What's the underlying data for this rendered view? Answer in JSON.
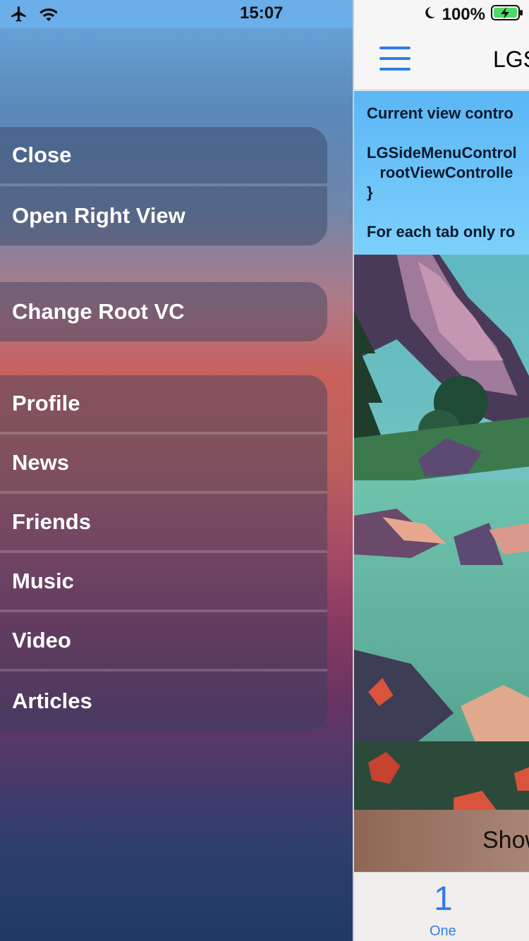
{
  "status_bar": {
    "time": "15:07",
    "battery_percent": "100%",
    "icons": [
      "airplane-icon",
      "wifi-icon",
      "moon-icon",
      "battery-charging-icon"
    ]
  },
  "side_menu": {
    "group1": [
      "Close",
      "Open Right View"
    ],
    "group2": [
      "Change Root VC"
    ],
    "group3": [
      "Profile",
      "News",
      "Friends",
      "Music",
      "Video",
      "Articles"
    ]
  },
  "navbar": {
    "title": "LGS",
    "menu_icon": "hamburger-menu-icon"
  },
  "info_text": {
    "line1": "Current view contro",
    "line2": "LGSideMenuControl",
    "line3": "   rootViewControlle",
    "line4": "}",
    "line5": "For each tab only ro"
  },
  "show_button": {
    "label": "Show"
  },
  "tab_bar": {
    "tabs": [
      {
        "number": "1",
        "label": "One"
      }
    ]
  },
  "colors": {
    "accent": "#2f7ee6",
    "info_box": "#6cc4f8",
    "menu_gradient_top": "#6aa8df",
    "menu_gradient_bottom": "#1e3a66"
  }
}
